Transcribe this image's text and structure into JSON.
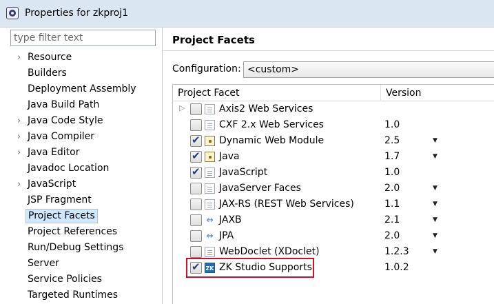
{
  "window": {
    "title": "Properties for zkproj1"
  },
  "filter": {
    "placeholder": "type filter text"
  },
  "tree": {
    "items": [
      {
        "label": "Resource",
        "expandable": true
      },
      {
        "label": "Builders",
        "expandable": false
      },
      {
        "label": "Deployment Assembly",
        "expandable": false
      },
      {
        "label": "Java Build Path",
        "expandable": false
      },
      {
        "label": "Java Code Style",
        "expandable": true
      },
      {
        "label": "Java Compiler",
        "expandable": true
      },
      {
        "label": "Java Editor",
        "expandable": true
      },
      {
        "label": "Javadoc Location",
        "expandable": false
      },
      {
        "label": "JavaScript",
        "expandable": true
      },
      {
        "label": "JSP Fragment",
        "expandable": false
      },
      {
        "label": "Project Facets",
        "expandable": false,
        "selected": true
      },
      {
        "label": "Project References",
        "expandable": false
      },
      {
        "label": "Run/Debug Settings",
        "expandable": false
      },
      {
        "label": "Server",
        "expandable": false
      },
      {
        "label": "Service Policies",
        "expandable": false
      },
      {
        "label": "Targeted Runtimes",
        "expandable": false
      }
    ]
  },
  "main": {
    "title": "Project Facets",
    "configuration_label": "Configuration:",
    "configuration_value": "<custom>",
    "table": {
      "col_facet": "Project Facet",
      "col_version": "Version",
      "rows": [
        {
          "name": "Axis2 Web Services",
          "version": "",
          "checked": false,
          "icon": "doc-icon",
          "expandable": true,
          "dropdown": false
        },
        {
          "name": "CXF 2.x Web Services",
          "version": "1.0",
          "checked": false,
          "icon": "doc-icon",
          "expandable": false,
          "dropdown": false
        },
        {
          "name": "Dynamic Web Module",
          "version": "2.5",
          "checked": true,
          "icon": "lock-icon",
          "expandable": false,
          "dropdown": true
        },
        {
          "name": "Java",
          "version": "1.7",
          "checked": true,
          "icon": "lock-icon",
          "expandable": false,
          "dropdown": true
        },
        {
          "name": "JavaScript",
          "version": "1.0",
          "checked": true,
          "icon": "doc-icon",
          "expandable": false,
          "dropdown": false
        },
        {
          "name": "JavaServer Faces",
          "version": "2.0",
          "checked": false,
          "icon": "doc-icon",
          "expandable": false,
          "dropdown": true
        },
        {
          "name": "JAX-RS (REST Web Services)",
          "version": "1.1",
          "checked": false,
          "icon": "doc-icon",
          "expandable": false,
          "dropdown": true
        },
        {
          "name": "JAXB",
          "version": "2.1",
          "checked": false,
          "icon": "arrows-icon",
          "expandable": false,
          "dropdown": true
        },
        {
          "name": "JPA",
          "version": "2.0",
          "checked": false,
          "icon": "arrows-icon",
          "expandable": false,
          "dropdown": true
        },
        {
          "name": "WebDoclet (XDoclet)",
          "version": "1.2.3",
          "checked": false,
          "icon": "doc-icon",
          "expandable": false,
          "dropdown": true
        },
        {
          "name": "ZK Studio Supports",
          "version": "1.0.2",
          "checked": true,
          "icon": "zk-icon",
          "expandable": false,
          "dropdown": false,
          "highlighted": true
        }
      ]
    }
  },
  "colors": {
    "highlight_border": "#c8102e",
    "selection_bg": "#cde8ff"
  }
}
